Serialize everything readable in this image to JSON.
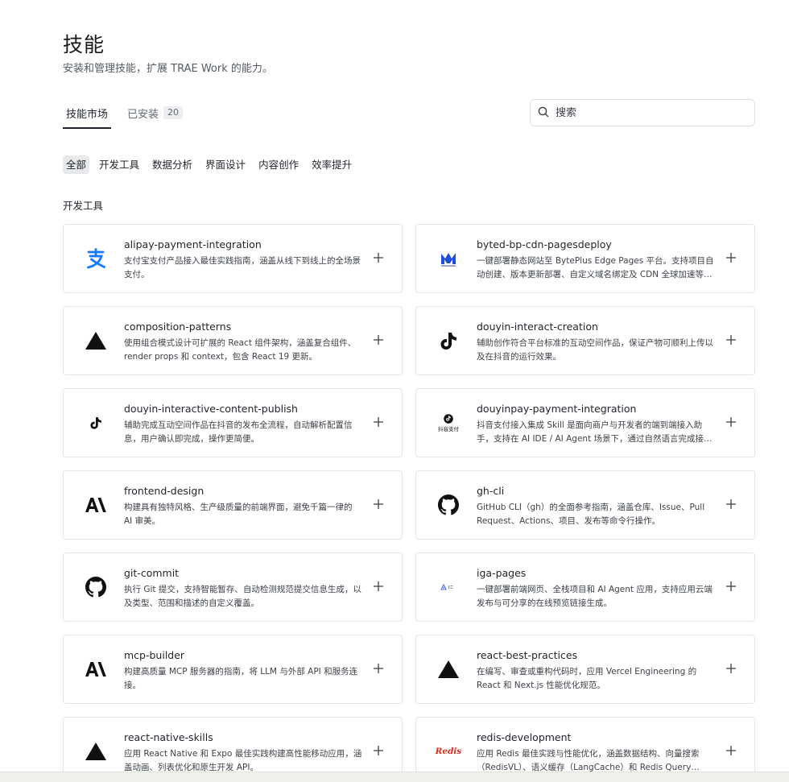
{
  "header": {
    "title": "技能",
    "subtitle": "安装和管理技能，扩展 TRAE Work 的能力。"
  },
  "tabs": [
    {
      "label": "技能市场",
      "active": true
    },
    {
      "label": "已安装",
      "count": "20",
      "active": false
    }
  ],
  "search": {
    "placeholder": "搜索",
    "icon": "search-icon"
  },
  "filters": [
    "全部",
    "开发工具",
    "数据分析",
    "界面设计",
    "内容创作",
    "效率提升"
  ],
  "active_filter": "全部",
  "section": {
    "title": "开发工具"
  },
  "skills": [
    {
      "name": "alipay-payment-integration",
      "desc": "支付宝支付产品接入最佳实践指南，涵盖从线下到线上的全场景支付。",
      "icon": "alipay-icon"
    },
    {
      "name": "byted-bp-cdn-pagesdeploy",
      "desc": "一键部署静态网站至 BytePlus Edge Pages 平台。支持项目自动创建、版本更新部署、自定义域名绑定及 CDN 全球加速等功能。",
      "icon": "byteplus-icon"
    },
    {
      "name": "composition-patterns",
      "desc": "使用组合模式设计可扩展的 React 组件架构，涵盖复合组件、render props 和 context，包含 React 19 更新。",
      "icon": "vercel-triangle-icon"
    },
    {
      "name": "douyin-interact-creation",
      "desc": "辅助创作符合平台标准的互动空间作品，保证产物可顺利上传以及在抖音的运行效果。",
      "icon": "tiktok-icon"
    },
    {
      "name": "douyin-interactive-content-publish",
      "desc": "辅助完成互动空间作品在抖音的发布全流程，自动解析配置信息，用户确认即完成，操作更简便。",
      "icon": "tiktok-small-icon"
    },
    {
      "name": "douyinpay-payment-integration",
      "desc": "抖音支付接入集成 Skill 是面向商户与开发者的端到端接入助手，支持在 AI IDE / AI Agent 场景下，通过自然语言完成接入流程。",
      "icon": "douyinpay-icon",
      "icon_caption": "抖音支付"
    },
    {
      "name": "frontend-design",
      "desc": "构建具有独特风格、生产级质量的前端界面，避免千篇一律的 AI 审美。",
      "icon": "anthropic-icon"
    },
    {
      "name": "gh-cli",
      "desc": "GitHub CLI（gh）的全面参考指南，涵盖仓库、Issue、Pull Request、Actions、项目、发布等命令行操作。",
      "icon": "github-icon"
    },
    {
      "name": "git-commit",
      "desc": "执行 Git 提交，支持智能暂存、自动检测规范提交信息生成，以及类型、范围和描述的自定义覆盖。",
      "icon": "github-icon"
    },
    {
      "name": "iga-pages",
      "desc": "一键部署前端网页、全栈项目和 AI Agent 应用，支持应用云端发布与可分享的在线预览链接生成。",
      "icon": "iga-icon"
    },
    {
      "name": "mcp-builder",
      "desc": "构建高质量 MCP 服务器的指南，将 LLM 与外部 API 和服务连接。",
      "icon": "anthropic-icon"
    },
    {
      "name": "react-best-practices",
      "desc": "在编写、审查或重构代码时，应用 Vercel Engineering 的 React 和 Next.js 性能优化规范。",
      "icon": "vercel-triangle-icon"
    },
    {
      "name": "react-native-skills",
      "desc": "应用 React Native 和 Expo 最佳实践构建高性能移动应用，涵盖动画、列表优化和原生开发 API。",
      "icon": "vercel-triangle-icon"
    },
    {
      "name": "redis-development",
      "desc": "应用 Redis 最佳实践与性能优化，涵盖数据结构、向量搜索（RedisVL）、语义缓存（LangCache）和 Redis Query Engine。",
      "icon": "redis-icon",
      "icon_caption": "Redis"
    }
  ],
  "colors": {
    "text_primary": "#1f2329",
    "text_secondary": "#3d4248",
    "border": "#e3e5e8",
    "chip_active_bg": "#e8e9eb",
    "alipay_blue": "#1677ff",
    "byteplus_blue": "#1d4ed8",
    "redis_red": "#d82c20"
  }
}
